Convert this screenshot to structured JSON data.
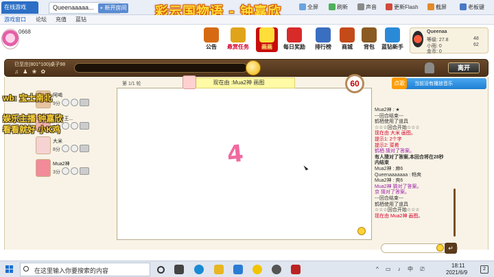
{
  "browser": {
    "tab_label": "在线游戏",
    "game_tab_label": "Queenaaaaa...",
    "game_tab_close": "×",
    "new_tab_label": "+ 新开房间",
    "toolbar": [
      "全屏",
      "刷新",
      "声音",
      "更新Flash",
      "截屏",
      "老板键"
    ]
  },
  "overlay_title": "彩云国物语 - 钟嘉欣",
  "subnav": [
    "游戏窗口",
    "论坛",
    "充值",
    "蓝钻"
  ],
  "user_id": "0668",
  "game_menu": [
    {
      "id": "menu-notice",
      "label": "公告",
      "color": "#d66a12"
    },
    {
      "id": "menu-task",
      "label": "悬赏任务",
      "color": "#e0a41a"
    },
    {
      "id": "menu-draw",
      "label": "画画",
      "color": "#ffde3a"
    },
    {
      "id": "menu-daily",
      "label": "每日奖励",
      "color": "#d92a2a"
    },
    {
      "id": "menu-rank",
      "label": "排行榜",
      "color": "#3a6ec0"
    },
    {
      "id": "menu-shop",
      "label": "商城",
      "color": "#c44a1a"
    },
    {
      "id": "menu-bag",
      "label": "背包",
      "color": "#8a5a22"
    },
    {
      "id": "menu-vip",
      "label": "蓝钻新手",
      "color": "#2a8ad8"
    }
  ],
  "user_card": {
    "name": "Queenaa",
    "level_label": "等级: 27.8",
    "exp": "48",
    "coins_label": "小雨: 0",
    "gold_label": "金币: 0",
    "extra": "62"
  },
  "room": {
    "name": "巳至庄(801^100)桌子98",
    "icons": "♫ ♟ ❀ ✿",
    "leave_label": "离开"
  },
  "players": [
    {
      "name": "阿喝",
      "score": "9分",
      "avatar_color": "#e8c3a0"
    },
    {
      "name": "Ahoe王...",
      "score": "8分",
      "avatar_color": "#f3b0b0"
    },
    {
      "name": "大米",
      "score": "8分",
      "avatar_color": "#f6d2d2"
    },
    {
      "name": "Mua2神",
      "score": "3分",
      "avatar_color": "#f28a9a"
    }
  ],
  "overlays": {
    "line1": "wb: 宝士南北",
    "line2": "娱乐主播 钟嘉欣",
    "line3": "看看就好 小K鸡"
  },
  "game": {
    "round_label": "第 1/1 轮",
    "drawer_banner": "现在由 :Mua2神 画图",
    "timer": "60",
    "drawn_text": "4"
  },
  "music": {
    "tag": "点歌",
    "text": "当前没有播放音乐"
  },
  "chat": [
    {
      "text": "Mua2神 : ★",
      "style": ""
    },
    {
      "text": "---回合结束---",
      "style": ""
    },
    {
      "text": "鹤栖使用了道具",
      "style": ""
    },
    {
      "text": "☆☆☆回合开始☆☆☆",
      "style": ""
    },
    {
      "text": "现在由 大米 画图。",
      "style": "red-name"
    },
    {
      "text": "提示1: 2个字",
      "style": "hint"
    },
    {
      "text": "提示2: 菜肴",
      "style": "hint"
    },
    {
      "text": "鹤栖 猜对了答案。",
      "style": "purple-name"
    },
    {
      "text": "有人猜对了答案,本回合将在28秒",
      "style": "bold"
    },
    {
      "text": "内结束",
      "style": "bold"
    },
    {
      "text": "Mua2神 : 麻6",
      "style": ""
    },
    {
      "text": "Queenaaaaaaa : 畅爽",
      "style": ""
    },
    {
      "text": "Mua2神 : 爽6",
      "style": ""
    },
    {
      "text": "Mua2神 猜对了答案。",
      "style": "purple-name"
    },
    {
      "text": "京 猜对了答案。",
      "style": "purple-name"
    },
    {
      "text": "---回合结束---",
      "style": ""
    },
    {
      "text": "鹤栖使用了道具",
      "style": ""
    },
    {
      "text": "☆☆☆回合开始☆☆☆",
      "style": ""
    },
    {
      "text": "现在由 Mua2神 画图。",
      "style": "red-name"
    }
  ],
  "chat_send": "↵",
  "taskbar": {
    "search_placeholder": "在这里输入你要搜索的内容",
    "time": "18:11",
    "date": "2021/6/9",
    "notif": "2",
    "tray": "^ ▭ ♪ 中 ⎚"
  }
}
